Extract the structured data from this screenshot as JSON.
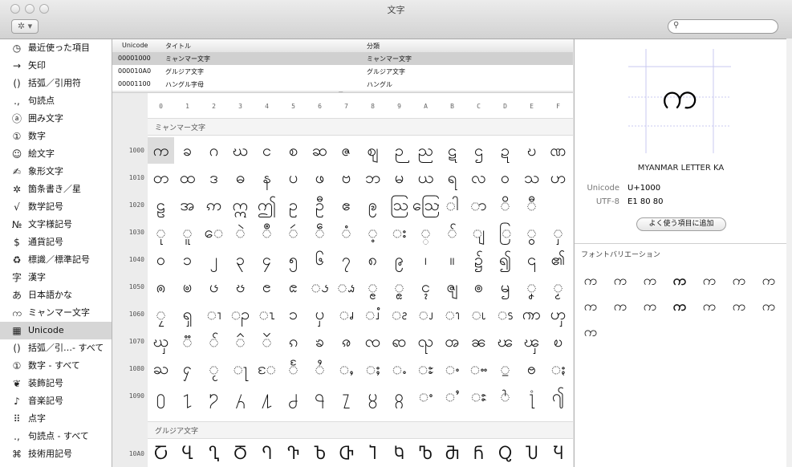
{
  "window": {
    "title": "文字"
  },
  "toolbar": {
    "gear": "✲ ▾",
    "search_placeholder": ""
  },
  "sidebar": {
    "items": [
      {
        "icon": "◷",
        "label": "最近使った項目",
        "icon_name": "recent-clock-icon"
      },
      {
        "icon": "→",
        "label": "矢印",
        "icon_name": "arrow-icon"
      },
      {
        "icon": "()",
        "label": "括弧／引用符",
        "icon_name": "parentheses-icon"
      },
      {
        "icon": ".,",
        "label": "句読点",
        "icon_name": "punctuation-icon"
      },
      {
        "icon": "ⓐ",
        "label": "囲み文字",
        "icon_name": "circled-letter-icon"
      },
      {
        "icon": "①",
        "label": "数字",
        "icon_name": "circled-number-icon"
      },
      {
        "icon": "☺",
        "label": "絵文字",
        "icon_name": "smiley-icon"
      },
      {
        "icon": "✍",
        "label": "象形文字",
        "icon_name": "pictograph-icon"
      },
      {
        "icon": "✲",
        "label": "箇条書き／星",
        "icon_name": "asterisk-icon"
      },
      {
        "icon": "√",
        "label": "数学記号",
        "icon_name": "square-root-icon"
      },
      {
        "icon": "№",
        "label": "文字様記号",
        "icon_name": "numero-icon"
      },
      {
        "icon": "$",
        "label": "通貨記号",
        "icon_name": "dollar-icon"
      },
      {
        "icon": "♻",
        "label": "標識／標準記号",
        "icon_name": "recycle-icon"
      },
      {
        "icon": "字",
        "label": "漢字",
        "icon_name": "kanji-icon"
      },
      {
        "icon": "あ",
        "label": "日本語かな",
        "icon_name": "kana-icon"
      },
      {
        "icon": "က",
        "label": "ミャンマー文字",
        "icon_name": "myanmar-icon"
      },
      {
        "icon": "▦",
        "label": "Unicode",
        "icon_name": "unicode-grid-icon"
      },
      {
        "icon": "()",
        "label": "括弧／引…- すべて",
        "icon_name": "parentheses-all-icon"
      },
      {
        "icon": "①",
        "label": "数字 - すべて",
        "icon_name": "numbers-all-icon"
      },
      {
        "icon": "❦",
        "label": "装飾記号",
        "icon_name": "ornament-icon"
      },
      {
        "icon": "♪",
        "label": "音楽記号",
        "icon_name": "music-note-icon"
      },
      {
        "icon": "⠿",
        "label": "点字",
        "icon_name": "braille-icon"
      },
      {
        "icon": ".,",
        "label": "句読点 - すべて",
        "icon_name": "punctuation-all-icon"
      },
      {
        "icon": "⌘",
        "label": "技術用記号",
        "icon_name": "command-icon"
      }
    ],
    "selected": 16
  },
  "list": {
    "headers": [
      "Unicode",
      "タイトル",
      "分類"
    ],
    "rows": [
      {
        "code": "00001000",
        "title": "ミャンマー文字",
        "cat": "ミャンマー文字"
      },
      {
        "code": "000010A0",
        "title": "グルジア文字",
        "cat": "グルジア文字"
      },
      {
        "code": "00001100",
        "title": "ハングル字母",
        "cat": "ハングル"
      }
    ],
    "selected": 0
  },
  "grid": {
    "cols": [
      "0",
      "1",
      "2",
      "3",
      "4",
      "5",
      "6",
      "7",
      "8",
      "9",
      "A",
      "B",
      "C",
      "D",
      "E",
      "F"
    ],
    "sections": [
      {
        "title": "ミャンマー文字",
        "rows": [
          {
            "label": "1000",
            "chars": "ကခဂဃငစဆဇဈဉညဋဌဍဎဏ"
          },
          {
            "label": "1010",
            "chars": "တထဒဓနပဖဗဘမယရလဝသဟ"
          },
          {
            "label": "1020",
            "chars": "ဠအဢဣဤဥဦဧဨဩဪါာိီ"
          },
          {
            "label": "1030",
            "chars": "ုူေဲဳဴဵံ့း္်ျြွှ"
          },
          {
            "label": "1040",
            "chars": "၀၁၂၃၄၅၆၇၈၉၊။၌၍၎၏"
          },
          {
            "label": "1050",
            "chars": "ၐၑၒၓၔၕၖၗၘၙၚၛၜၝၞၟ"
          },
          {
            "label": "1060",
            "chars": "ၠၡၢၣၤၥၦၧၨၩၪၫၬၭၮၯ"
          },
          {
            "label": "1070",
            "chars": "ၰၱၲၳၴၵၶၷၸၹၺၻၼၽၾၿ"
          },
          {
            "label": "1080",
            "chars": "ႀႁႂႃႄႅႆႇႈႉႊႋႌႍႎႏ"
          },
          {
            "label": "1090",
            "chars": "႐႑႒႓႔႕႖႗႘႙ႚႛႜႝ႞႟"
          }
        ]
      },
      {
        "title": "グルジア文字",
        "rows": [
          {
            "label": "10A0",
            "chars": "ႠႡႢႣႤႥႦႧႨႩႪႫႬႭႮႯ"
          }
        ]
      }
    ],
    "selected": {
      "section": 0,
      "row": 0,
      "col": 0
    }
  },
  "detail": {
    "glyph": "က",
    "name": "MYANMAR LETTER KA",
    "unicode_label": "Unicode",
    "unicode_value": "U+1000",
    "utf8_label": "UTF-8",
    "utf8_value": "E1 80 80",
    "add_button": "よく使う項目に追加",
    "font_variations_title": "フォントバリエーション",
    "variations": [
      "က",
      "က",
      "က",
      "က",
      "က",
      "က",
      "က",
      "က",
      "က",
      "က",
      "က",
      "က",
      "က",
      "က",
      "က"
    ]
  }
}
